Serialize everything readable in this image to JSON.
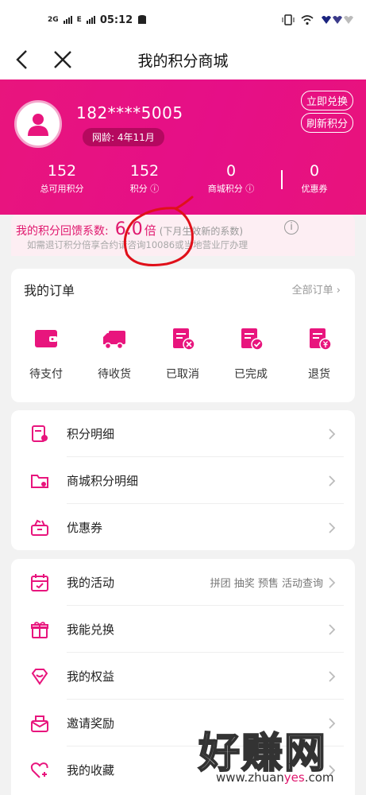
{
  "status": {
    "time": "05:12",
    "signal_a": "2G",
    "signal_b": "E"
  },
  "nav": {
    "title": "我的积分商城"
  },
  "user": {
    "phone": "182****5005",
    "network_age": "网龄: 4年11月"
  },
  "header_buttons": {
    "exchange": "立即兑换",
    "refresh": "刷新积分"
  },
  "stats": [
    {
      "value": "152",
      "label": "总可用积分"
    },
    {
      "value": "152",
      "label": "积分 ⓘ"
    },
    {
      "value": "0",
      "label": "商城积分 ⓘ"
    },
    {
      "value": "0",
      "label": "优惠券"
    }
  ],
  "coefficient": {
    "label": "我的积分回馈系数:",
    "value": "6.0",
    "unit": "倍",
    "note": "(下月生效新的系数)",
    "tip": "如需退订积分倍享合约请咨询10086或当地营业厅办理"
  },
  "orders": {
    "title": "我的订单",
    "all": "全部订单 ›",
    "items": [
      "待支付",
      "待收货",
      "已取消",
      "已完成",
      "退货"
    ]
  },
  "menu1": [
    "积分明细",
    "商城积分明细",
    "优惠券"
  ],
  "menu2": [
    {
      "label": "我的活动",
      "extra": "拼团 抽奖 预售 活动查询"
    },
    {
      "label": "我能兑换",
      "extra": ""
    },
    {
      "label": "我的权益",
      "extra": ""
    },
    {
      "label": "邀请奖励",
      "extra": ""
    },
    {
      "label": "我的收藏",
      "extra": ""
    }
  ],
  "watermark": {
    "big": "好赚网",
    "url_a": "www.zhuan",
    "url_b": "yes",
    "url_c": ".com"
  },
  "colors": {
    "brand": "#e60f87",
    "accent_text": "#e0176e",
    "icon": "#e8157d"
  }
}
